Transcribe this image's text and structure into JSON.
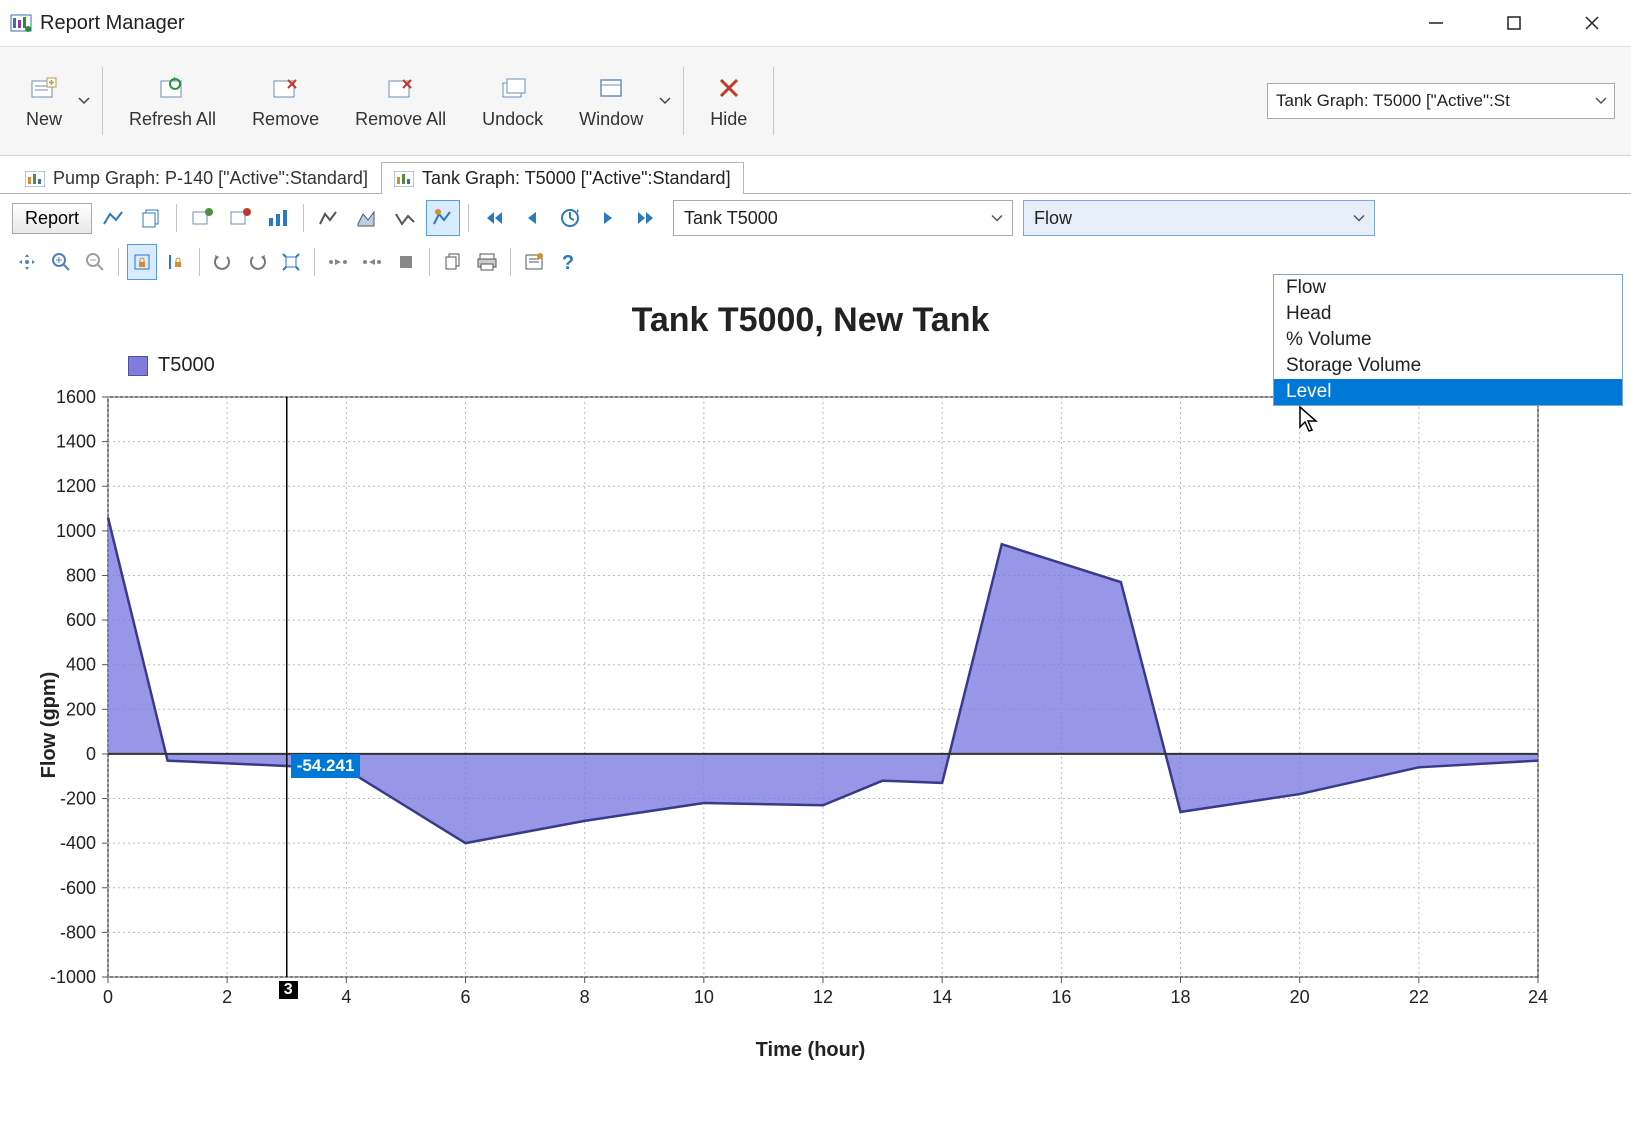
{
  "window": {
    "title": "Report Manager"
  },
  "ribbon": {
    "new": "New",
    "refresh_all": "Refresh All",
    "remove": "Remove",
    "remove_all": "Remove All",
    "undock": "Undock",
    "window": "Window",
    "hide": "Hide",
    "report_combo": "Tank Graph: T5000 [\"Active\":St"
  },
  "tabs": [
    {
      "label": "Pump Graph: P-140 [\"Active\":Standard]"
    },
    {
      "label": "Tank Graph: T5000 [\"Active\":Standard]"
    }
  ],
  "graphbar": {
    "report_button": "Report",
    "element_combo": "Tank T5000",
    "attribute_combo": "Flow",
    "attribute_options": [
      "Flow",
      "Head",
      "% Volume",
      "Storage Volume",
      "Level"
    ]
  },
  "chart_data": {
    "type": "area",
    "title": "Tank T5000, New Tank",
    "xlabel": "Time (hour)",
    "ylabel": "Flow (gpm)",
    "xlim": [
      0,
      24
    ],
    "ylim": [
      -1000,
      1600
    ],
    "xticks": [
      0,
      2,
      4,
      6,
      8,
      10,
      12,
      14,
      16,
      18,
      20,
      22,
      24
    ],
    "yticks": [
      -1000,
      -800,
      -600,
      -400,
      -200,
      0,
      200,
      400,
      600,
      800,
      1000,
      1200,
      1400,
      1600
    ],
    "series_name": "T5000",
    "x": [
      0,
      1,
      3,
      4,
      6,
      8,
      10,
      12,
      13,
      14,
      15,
      17,
      18,
      20,
      22,
      24
    ],
    "values": [
      1060,
      -30,
      -54.241,
      -70,
      -400,
      -300,
      -220,
      -230,
      -120,
      -130,
      940,
      770,
      -260,
      -180,
      -60,
      -30
    ],
    "cursor": {
      "x": 3,
      "value": -54.241
    }
  }
}
